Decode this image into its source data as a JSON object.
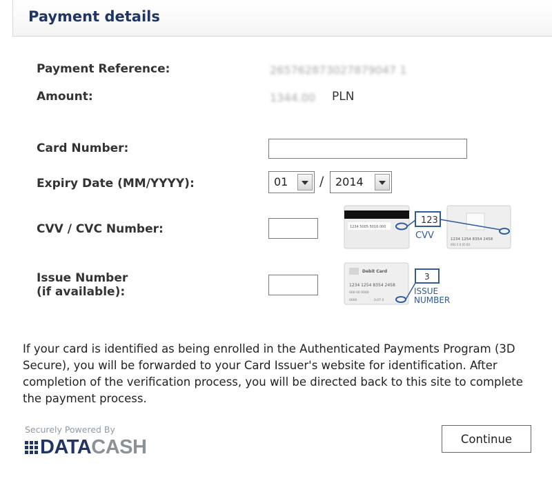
{
  "header": {
    "title": "Payment details"
  },
  "details": {
    "reference_label": "Payment Reference:",
    "reference_value": "265762873027879047 1",
    "amount_label": "Amount:",
    "amount_value": "1344.00",
    "amount_currency": "PLN"
  },
  "form": {
    "card_number_label": "Card Number:",
    "card_number_value": "",
    "expiry_label": "Expiry Date (MM/YYYY):",
    "expiry_month": "01",
    "expiry_separator": "/",
    "expiry_year": "2014",
    "cvv_label": "CVV / CVC Number:",
    "cvv_value": "",
    "issue_label_line1": "Issue Number",
    "issue_label_line2": "(if available):",
    "issue_value": ""
  },
  "illustrations": {
    "cvv_card": {
      "code": "123",
      "caption": "CVV",
      "stripe_numbers": "1234  5005  5016  000",
      "front_number": "1234 1254 8354 2458",
      "front_small": "000 5 6 05 60"
    },
    "issue_card": {
      "card_title": "Debit Card",
      "number": "1234 1254 8354 2458",
      "small_left": "000 00 0000",
      "small_bottom_left": "0000",
      "small_bottom_mid": "0.07 0",
      "code": "3",
      "caption_line1": "ISSUE",
      "caption_line2": "NUMBER"
    }
  },
  "info_text": "If your card is identified as being enrolled in the Authenticated Payments Program (3D Secure), you will be forwarded to your Card Issuer's website for identification. After completion of the verification process, you will be directed back to this site to complete the payment process.",
  "footer": {
    "powered_by": "Securely Powered By",
    "logo_part1": "DATA",
    "logo_part2": "CASH",
    "continue_label": "Continue"
  },
  "colors": {
    "title_blue": "#1f3565",
    "illustration_blue": "#2f5b9a"
  }
}
